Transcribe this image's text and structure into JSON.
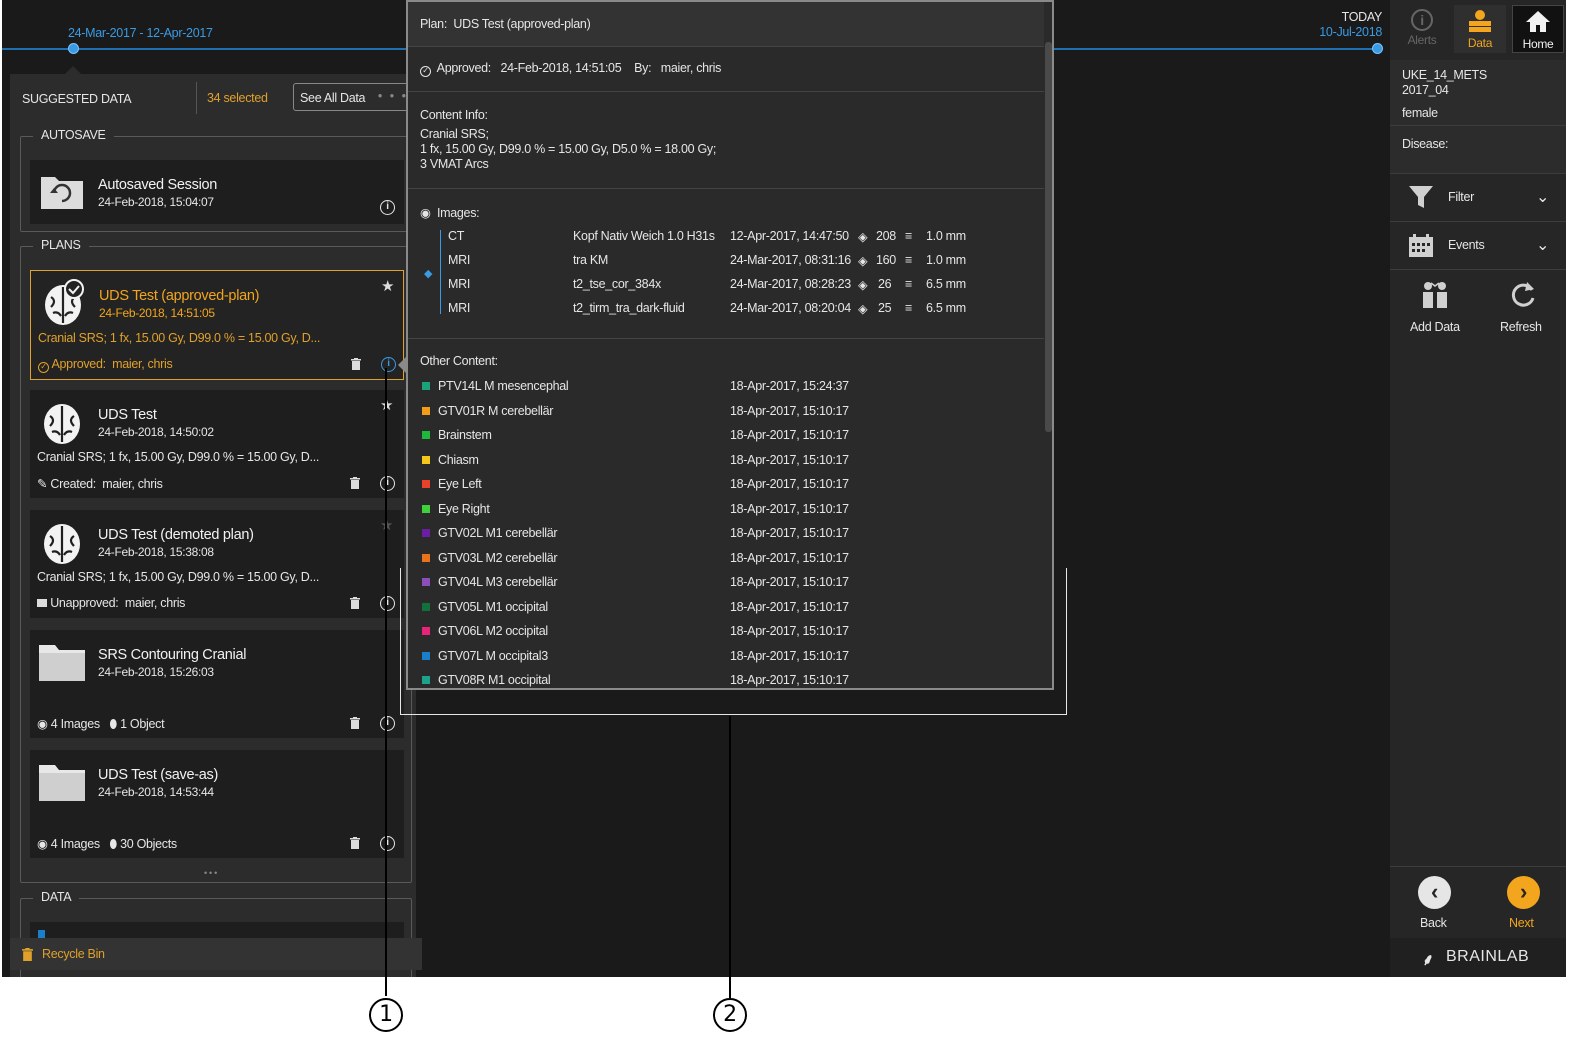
{
  "timeline": {
    "range": "24-Mar-2017 - 12-Apr-2017",
    "today_label": "TODAY",
    "today_date": "10-Jul-2018"
  },
  "left_panel": {
    "tab_suggested": "SUGGESTED DATA",
    "selected_count": "34 selected",
    "see_all": "See All Data",
    "autosave_title": "AUTOSAVE",
    "autosave": {
      "title": "Autosaved Session",
      "date": "24-Feb-2018, 15:04:07"
    },
    "plans_title": "PLANS",
    "plans": [
      {
        "title": "UDS Test (approved-plan)",
        "date": "24-Feb-2018, 14:51:05",
        "desc": "Cranial SRS; 1 fx, 15.00 Gy, D99.0 % = 15.00 Gy, D...",
        "status_label": "Approved:",
        "status_user": "maier, chris"
      },
      {
        "title": "UDS Test",
        "date": "24-Feb-2018, 14:50:02",
        "desc": "Cranial SRS; 1 fx, 15.00 Gy, D99.0 % = 15.00 Gy, D...",
        "status_label": "Created:",
        "status_user": "maier, chris"
      },
      {
        "title": "UDS Test (demoted plan)",
        "date": "24-Feb-2018, 15:38:08",
        "desc": "Cranial SRS; 1 fx, 15.00 Gy, D99.0 % = 15.00 Gy, D...",
        "status_label": "Unapproved:",
        "status_user": "maier, chris"
      },
      {
        "title": "SRS Contouring Cranial",
        "date": "24-Feb-2018, 15:26:03",
        "images": "4 Images",
        "objects": "1 Object"
      },
      {
        "title": "UDS Test (save-as)",
        "date": "24-Feb-2018, 14:53:44",
        "images": "4 Images",
        "objects": "30 Objects"
      }
    ],
    "more_dots": "• • •",
    "data_title": "DATA",
    "recycle_bin": "Recycle Bin"
  },
  "popup": {
    "plan_label": "Plan:",
    "plan_name": "UDS Test (approved-plan)",
    "approved_label": "Approved:",
    "approved_date": "24-Feb-2018, 14:51:05",
    "by_label": "By:",
    "by_user": "maier, chris",
    "content_info_label": "Content Info:",
    "content_lines": [
      "Cranial SRS;",
      "1 fx, 15.00 Gy, D99.0 % = 15.00 Gy, D5.0 % = 18.00 Gy;",
      "3 VMAT Arcs"
    ],
    "images_label": "Images:",
    "images": [
      {
        "modality": "CT",
        "name": "Kopf Nativ Weich 1.0 H31s",
        "date": "12-Apr-2017, 14:47:50",
        "slices": "208",
        "thickness": "1.0 mm"
      },
      {
        "modality": "MRI",
        "name": "tra KM",
        "date": "24-Mar-2017, 08:31:16",
        "slices": "160",
        "thickness": "1.0 mm"
      },
      {
        "modality": "MRI",
        "name": "t2_tse_cor_384x",
        "date": "24-Mar-2017, 08:28:23",
        "slices": "26",
        "thickness": "6.5 mm"
      },
      {
        "modality": "MRI",
        "name": "t2_tirm_tra_dark-fluid",
        "date": "24-Mar-2017, 08:20:04",
        "slices": "25",
        "thickness": "6.5 mm"
      }
    ],
    "other_label": "Other Content:",
    "other": [
      {
        "name": "PTV14L M mesencephal",
        "date": "18-Apr-2017, 15:24:37",
        "color": "#1aa37a"
      },
      {
        "name": "GTV01R M cerebellär",
        "date": "18-Apr-2017, 15:10:17",
        "color": "#f39c1a"
      },
      {
        "name": "Brainstem",
        "date": "18-Apr-2017, 15:10:17",
        "color": "#1fb83a"
      },
      {
        "name": "Chiasm",
        "date": "18-Apr-2017, 15:10:17",
        "color": "#f2c81a"
      },
      {
        "name": "Eye Left",
        "date": "18-Apr-2017, 15:10:17",
        "color": "#e8432a"
      },
      {
        "name": "Eye Right",
        "date": "18-Apr-2017, 15:10:17",
        "color": "#3fd13a"
      },
      {
        "name": "GTV02L M1 cerebellär",
        "date": "18-Apr-2017, 15:10:17",
        "color": "#6a1fa3"
      },
      {
        "name": "GTV03L M2 cerebellär",
        "date": "18-Apr-2017, 15:10:17",
        "color": "#e8731a"
      },
      {
        "name": "GTV04L M3 cerebellär",
        "date": "18-Apr-2017, 15:10:17",
        "color": "#8a4fb8"
      },
      {
        "name": "GTV05L M1 occipital",
        "date": "18-Apr-2017, 15:10:17",
        "color": "#14703a"
      },
      {
        "name": "GTV06L M2 occipital",
        "date": "18-Apr-2017, 15:10:17",
        "color": "#e8237a"
      },
      {
        "name": "GTV07L M occipital3",
        "date": "18-Apr-2017, 15:10:17",
        "color": "#1a7fc8"
      },
      {
        "name": "GTV08R M1 occipital",
        "date": "18-Apr-2017, 15:10:17",
        "color": "#1aa38a"
      }
    ]
  },
  "right_panel": {
    "alerts": "Alerts",
    "data": "Data",
    "home": "Home",
    "patient_name": "UKE_14_METS",
    "patient_id": "2017_04",
    "sex": "female",
    "disease_label": "Disease:",
    "filter": "Filter",
    "events": "Events",
    "add_data": "Add Data",
    "refresh": "Refresh",
    "back": "Back",
    "next": "Next",
    "brand": "BRAINLAB"
  },
  "callouts": {
    "one": "1",
    "two": "2"
  }
}
